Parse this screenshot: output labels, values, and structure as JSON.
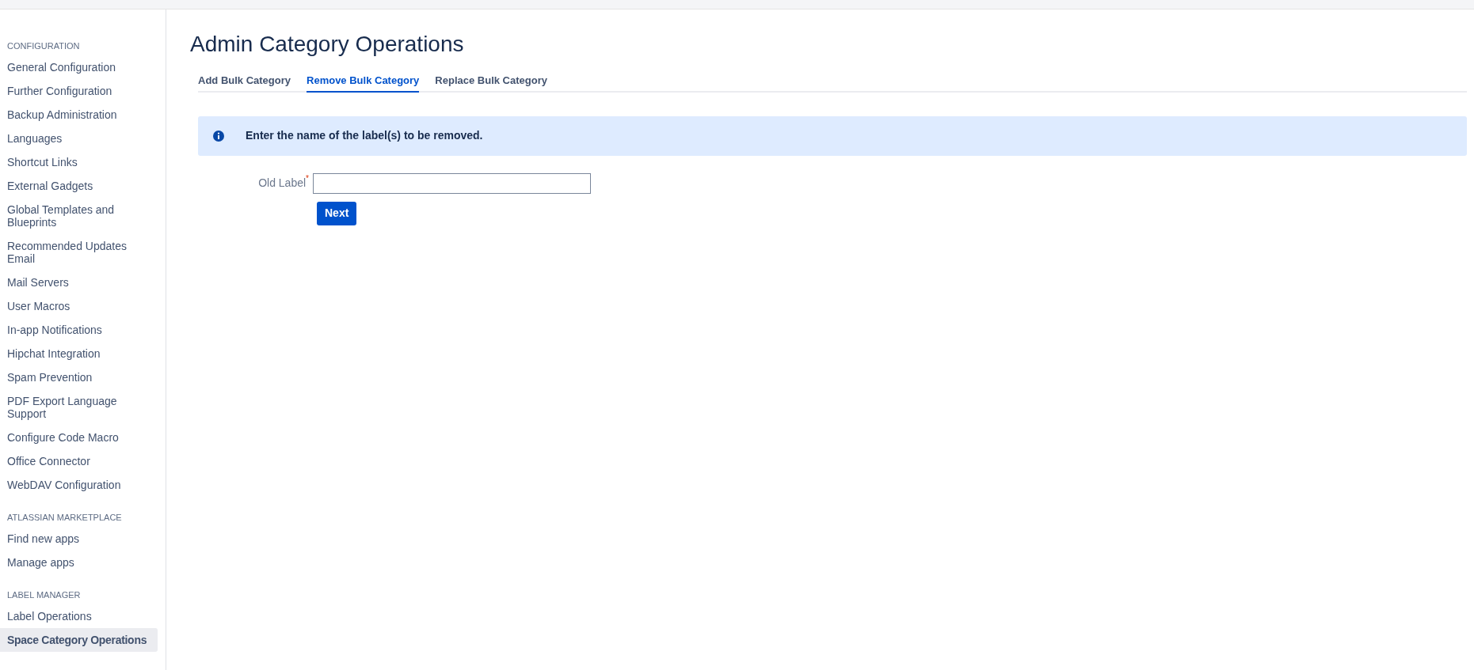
{
  "sidebar": {
    "sections": [
      {
        "heading": "CONFIGURATION",
        "items": [
          {
            "label": "General Configuration",
            "selected": false
          },
          {
            "label": "Further Configuration",
            "selected": false
          },
          {
            "label": "Backup Administration",
            "selected": false
          },
          {
            "label": "Languages",
            "selected": false
          },
          {
            "label": "Shortcut Links",
            "selected": false
          },
          {
            "label": "External Gadgets",
            "selected": false
          },
          {
            "label": "Global Templates and Blueprints",
            "selected": false
          },
          {
            "label": "Recommended Updates Email",
            "selected": false
          },
          {
            "label": "Mail Servers",
            "selected": false
          },
          {
            "label": "User Macros",
            "selected": false
          },
          {
            "label": "In-app Notifications",
            "selected": false
          },
          {
            "label": "Hipchat Integration",
            "selected": false
          },
          {
            "label": "Spam Prevention",
            "selected": false
          },
          {
            "label": "PDF Export Language Support",
            "selected": false
          },
          {
            "label": "Configure Code Macro",
            "selected": false
          },
          {
            "label": "Office Connector",
            "selected": false
          },
          {
            "label": "WebDAV Configuration",
            "selected": false
          }
        ]
      },
      {
        "heading": "ATLASSIAN MARKETPLACE",
        "items": [
          {
            "label": "Find new apps",
            "selected": false
          },
          {
            "label": "Manage apps",
            "selected": false
          }
        ]
      },
      {
        "heading": "LABEL MANAGER",
        "items": [
          {
            "label": "Label Operations",
            "selected": false
          },
          {
            "label": "Space Category Operations",
            "selected": true
          }
        ]
      }
    ]
  },
  "page": {
    "title": "Admin Category Operations",
    "tabs": [
      {
        "label": "Add Bulk Category",
        "selected": false
      },
      {
        "label": "Remove Bulk Category",
        "selected": true
      },
      {
        "label": "Replace Bulk Category",
        "selected": false
      }
    ],
    "info_message": "Enter the name of the label(s) to be removed.",
    "form": {
      "field": {
        "label": "Old Label",
        "required_mark": "*"
      },
      "submit_button": "Next"
    }
  }
}
